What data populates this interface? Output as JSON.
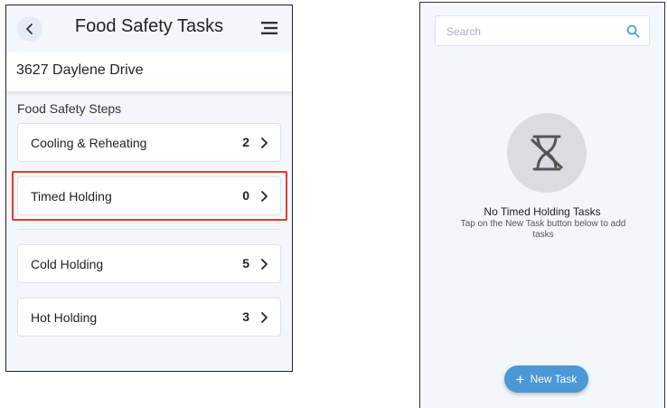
{
  "left_screen": {
    "title": "Food Safety Tasks",
    "location": "3627 Daylene Drive",
    "section_label": "Food Safety Steps",
    "steps": [
      {
        "name": "Cooling & Reheating",
        "count": "2"
      },
      {
        "name": "Timed Holding",
        "count": "0"
      },
      {
        "name": "Cold Holding",
        "count": "5"
      },
      {
        "name": "Hot Holding",
        "count": "3"
      }
    ],
    "highlighted_step": "Timed Holding",
    "icons": {
      "back": "chevron-left-icon",
      "menu": "menu-icon",
      "row": "chevron-right-icon"
    }
  },
  "right_screen": {
    "search": {
      "placeholder": "Search",
      "value": ""
    },
    "empty_state": {
      "icon": "hourglass-off-icon",
      "title": "No Timed Holding Tasks",
      "message": "Tap on the New Task button below to add tasks"
    },
    "new_task_button": {
      "icon": "+",
      "label": "New Task"
    }
  },
  "colors": {
    "accent": "#4b97d8",
    "highlight": "#e23b2c",
    "background": "#f3f7fb"
  }
}
